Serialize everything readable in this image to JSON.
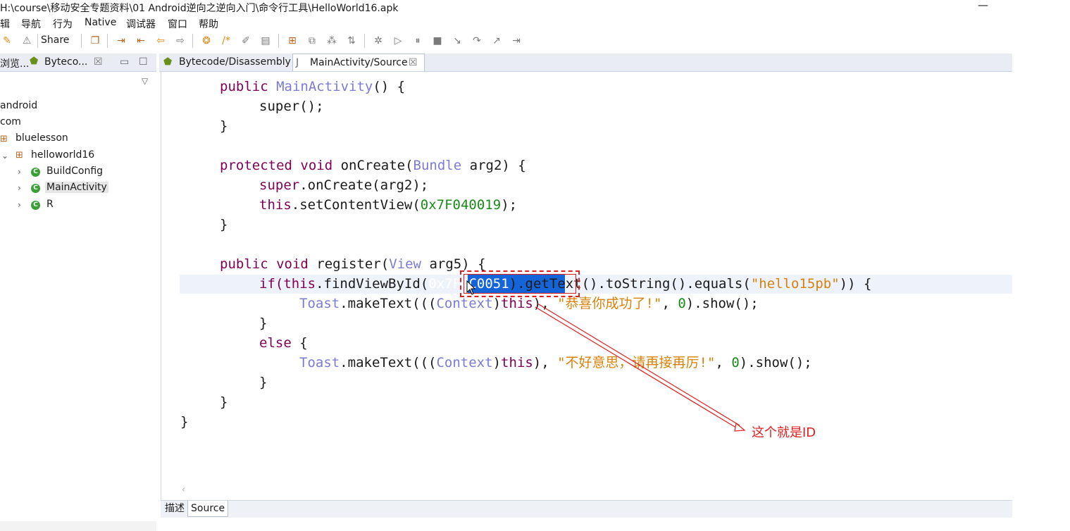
{
  "window": {
    "title": "H:\\course\\移动安全专题资料\\01 Android逆向之逆向入门\\命令行工具\\HelloWorld16.apk",
    "minimize": "—"
  },
  "menu": [
    "辑",
    "导航",
    "行为",
    "Native",
    "调试器",
    "窗口",
    "帮助"
  ],
  "toolbar": {
    "share_label": "Share"
  },
  "left_panel": {
    "tabs": [
      {
        "label": "浏览..."
      },
      {
        "label": "Byteco..."
      }
    ],
    "close": "☒",
    "tree": {
      "android": "android",
      "com": "com",
      "bluelesson": "bluelesson",
      "helloworld16": "helloworld16",
      "buildconfig": "BuildConfig",
      "mainactivity": "MainActivity",
      "r": "R"
    }
  },
  "editor": {
    "tabs": [
      {
        "label": "Bytecode/Disassembly"
      },
      {
        "label": "MainActivity/Source"
      }
    ],
    "bottom_tabs": [
      {
        "label": "描述"
      },
      {
        "label": "Source"
      }
    ],
    "code": {
      "l1_kw": "public ",
      "l1_ty": "MainActivity",
      "l1_rest": "() {",
      "l2": "super();",
      "l3": "}",
      "l4_kw": "protected void ",
      "l4_fn": "onCreate(",
      "l4_ty": "Bundle",
      "l4_rest": " arg2) {",
      "l5_kw": "super",
      "l5_rest": ".onCreate(arg2);",
      "l6_kw": "this",
      "l6_rest": ".setContentView(",
      "l6_num": "0x7F040019",
      "l6_end": ");",
      "l7": "}",
      "l8_kw": "public void ",
      "l8_fn": "register(",
      "l8_ty": "View",
      "l8_rest": " arg5) {",
      "l9_kw1": "if(",
      "l9_kw2": "this",
      "l9_rest1": ".findViewById(",
      "l9_sel": "0x7F0C0051",
      "l9_rest2": ").getText().toString().equals(",
      "l9_str": "\"hello15pb\"",
      "l9_end": ")) {",
      "l10_ty": "Toast",
      "l10_rest1": ".makeText(((",
      "l10_ty2": "Context",
      "l10_rest2": ")",
      "l10_kw": "this",
      "l10_rest3": "), ",
      "l10_str": "\"恭喜你成功了!\"",
      "l10_rest4": ", ",
      "l10_num": "0",
      "l10_end": ").show();",
      "l11": "}",
      "l12_kw": "else",
      "l12_rest": " {",
      "l13_ty": "Toast",
      "l13_rest1": ".makeText(((",
      "l13_ty2": "Context",
      "l13_rest2": ")",
      "l13_kw": "this",
      "l13_rest3": "), ",
      "l13_str": "\"不好意思，请再接再厉!\"",
      "l13_rest4": ", ",
      "l13_num": "0",
      "l13_end": ").show();",
      "l14": "}",
      "l15": "}",
      "l16": "}"
    }
  },
  "annotation": {
    "text": "这个就是ID"
  },
  "colors": {
    "keyword": "#7f0055",
    "type": "#7b7bd6",
    "number": "#1a8a1a",
    "string": "#d9820a",
    "annotation": "#e02020",
    "selection": "#1565d8"
  }
}
